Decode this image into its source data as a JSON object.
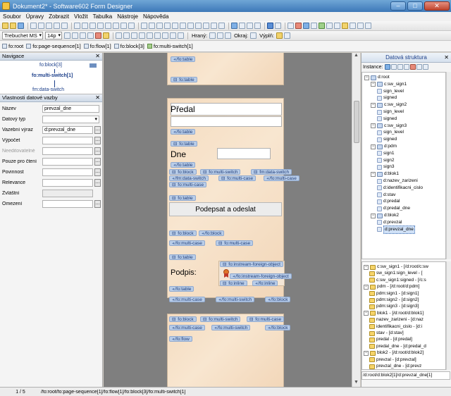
{
  "window": {
    "title": "Dokument2* - Software602 Form Designer"
  },
  "menu": [
    "Soubor",
    "Úpravy",
    "Zobrazit",
    "Vložit",
    "Tabulka",
    "Nástroje",
    "Nápověda"
  ],
  "format_bar": {
    "font": "Trebuchet MS",
    "size": "14p",
    "borders_label": "Hraný:",
    "margins_label": "Okraj:",
    "fill_label": "Výplň:"
  },
  "breadcrumb": [
    "fo:root",
    "fo:page-sequence[1]",
    "fo:flow[1]",
    "fo:block[3]",
    "fo:multi-switch[1]"
  ],
  "navigation": {
    "title": "Navigace",
    "lines": [
      "fo:block[3]",
      "fo:multi-switch[1]",
      "fm:data-switch"
    ]
  },
  "properties": {
    "title": "Vlastnosti datové vazby",
    "rows": [
      {
        "label": "Název",
        "value": "prevzal_dne",
        "type": "text"
      },
      {
        "label": "Datový typ",
        "value": "",
        "type": "select"
      },
      {
        "label": "Vazební výraz",
        "value": "d:prevzal_dne",
        "type": "button"
      },
      {
        "label": "Výpočet",
        "value": "",
        "type": "button"
      },
      {
        "label": "Needitovatelné",
        "value": "",
        "type": "button",
        "disabled": true
      },
      {
        "label": "Pouze pro čtení",
        "value": "",
        "type": "button"
      },
      {
        "label": "Povinnost",
        "value": "",
        "type": "button"
      },
      {
        "label": "Relevance",
        "value": "",
        "type": "button"
      },
      {
        "label": "Zvláštní",
        "value": "",
        "type": "grey"
      },
      {
        "label": "Omezení",
        "value": "",
        "type": "button"
      }
    ]
  },
  "canvas": {
    "page1_tags": [
      "/fo:table",
      "fo:table"
    ],
    "predal_title": "Předal",
    "dne_title": "Dne",
    "sign_button": "Podepsat a odeslat",
    "podpis_label": "Podpis:",
    "page2_tags": {
      "t_table1": "/fo:table",
      "t_table2": "fo:table",
      "t_table3": "/fo:table",
      "t_block1": "fo:block",
      "t_ms1": "fo:multi-switch",
      "t_ds1": "fm:data-switch",
      "t_ds2": "/fm:data-switch",
      "t_mc1": "fo:multi-case",
      "t_mc2": "/fo:multi-case",
      "t_mc3": "fo:multi-case",
      "t_table4": "fo:table",
      "t_block2": "fo:block",
      "t_block3": "/fo:block",
      "t_mc4": "/fo:multi-case",
      "t_mc5": "fo:multi-case",
      "t_table5": "fo:table",
      "t_ifo1": "fo:instream-foreign-object",
      "t_ifo2": "/fo:instream-foreign-object",
      "t_inl1": "fo:inline",
      "t_inl2": "/fo:inline",
      "t_table6": "/fo:table",
      "t_mc6": "/fo:multi-case",
      "t_ms2": "/fo:multi-switch",
      "t_block4": "/fo:block"
    },
    "page3_tags": {
      "t_block": "fo:block",
      "t_ms": "fo:multi-switch",
      "t_mc": "fo:multi-case",
      "t_mc_end": "/fo:multi-case",
      "t_ms_end": "/fo:multi-switch",
      "t_block_end": "/fo:block",
      "t_flow_end": "/fo:flow"
    }
  },
  "datastructure": {
    "title": "Datová struktura",
    "instance_label": "Instance:",
    "tree": [
      {
        "text": "d:root",
        "level": 0,
        "type": "folder"
      },
      {
        "text": "c:sw_sign1",
        "level": 1,
        "type": "folder"
      },
      {
        "text": "sign_level",
        "level": 2,
        "type": "leaf"
      },
      {
        "text": "signed",
        "level": 2,
        "type": "leaf"
      },
      {
        "text": "c:sw_sign2",
        "level": 1,
        "type": "folder"
      },
      {
        "text": "sign_level",
        "level": 2,
        "type": "leaf"
      },
      {
        "text": "signed",
        "level": 2,
        "type": "leaf"
      },
      {
        "text": "c:sw_sign3",
        "level": 1,
        "type": "folder"
      },
      {
        "text": "sign_level",
        "level": 2,
        "type": "leaf"
      },
      {
        "text": "signed",
        "level": 2,
        "type": "leaf"
      },
      {
        "text": "d:pdm",
        "level": 1,
        "type": "folder"
      },
      {
        "text": "sign1",
        "level": 2,
        "type": "leaf"
      },
      {
        "text": "sign2",
        "level": 2,
        "type": "leaf"
      },
      {
        "text": "sign3",
        "level": 2,
        "type": "leaf"
      },
      {
        "text": "d:blok1",
        "level": 1,
        "type": "folder"
      },
      {
        "text": "d:nazev_zarizeni",
        "level": 2,
        "type": "leaf"
      },
      {
        "text": "d:identifikacni_cislo",
        "level": 2,
        "type": "leaf"
      },
      {
        "text": "d:stav",
        "level": 2,
        "type": "leaf"
      },
      {
        "text": "d:predal",
        "level": 2,
        "type": "leaf"
      },
      {
        "text": "d:predal_dne",
        "level": 2,
        "type": "leaf"
      },
      {
        "text": "d:blok2",
        "level": 1,
        "type": "folder"
      },
      {
        "text": "d:prevzal",
        "level": 2,
        "type": "leaf"
      },
      {
        "text": "d:prevzal_dne",
        "level": 2,
        "type": "leaf",
        "selected": true
      }
    ],
    "tree2": [
      {
        "text": "c:sw_sign1 - [/d:root/c:sw",
        "level": 0
      },
      {
        "text": "sw_sign1:sign_level - [",
        "level": 1
      },
      {
        "text": "c:sw_sign1:signed - [/c:s",
        "level": 1
      },
      {
        "text": "pdm - [/d:root/d:pdm]",
        "level": 0
      },
      {
        "text": "pdm:sign1 - [d:sign1]",
        "level": 1
      },
      {
        "text": "pdm:sign2 - [d:sign2]",
        "level": 1
      },
      {
        "text": "pdm:sign3 - [d:sign3]",
        "level": 1
      },
      {
        "text": "blok1 - [/d:root/d:blok1]",
        "level": 0
      },
      {
        "text": "nazev_zarizeni - [d:naz",
        "level": 1
      },
      {
        "text": "identifikacni_cislo - [d:i",
        "level": 1
      },
      {
        "text": "stav - [d:stav]",
        "level": 1
      },
      {
        "text": "predal - [d:predal]",
        "level": 1
      },
      {
        "text": "predal_dne - [d:predal_d",
        "level": 1
      },
      {
        "text": "blok2 - [/d:root/d:blok2]",
        "level": 0
      },
      {
        "text": "prevzal - [d:prevzal]",
        "level": 1
      },
      {
        "text": "prevzal_dne - [d:prevz",
        "level": 1
      }
    ],
    "path": "/d:root/d:blok2[1]/d:prevzal_dne[1]"
  },
  "status": {
    "page": "1 / 5",
    "path": "/fo:root/fo:page-sequence[1]/fo:flow[1]/fo:block[3]/fo:multi-switch[1]"
  }
}
